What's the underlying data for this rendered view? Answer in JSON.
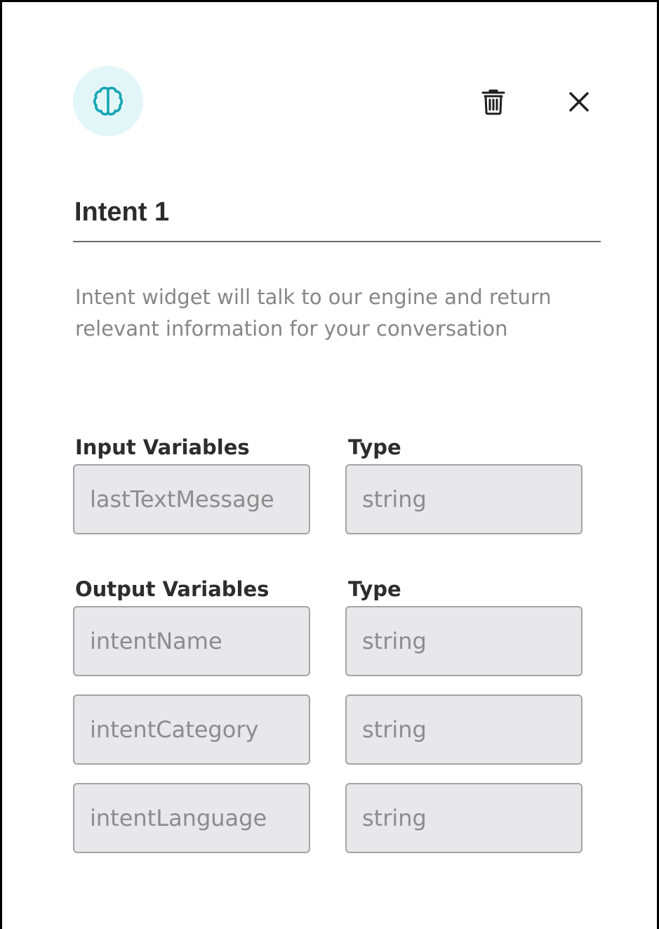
{
  "colors": {
    "accent": "#14a6b4",
    "icon_bg": "#e3f6f7",
    "field_bg": "#e8e8eb",
    "field_border": "#a3a3a8",
    "text_muted": "#868686",
    "text_dark": "#2d2d2d"
  },
  "header": {
    "widget_icon": "brain-icon",
    "delete_icon": "trash-icon",
    "close_icon": "close-icon"
  },
  "widget": {
    "title": "Intent 1",
    "description": "Intent widget will talk to our engine and return relevant information for your conversation"
  },
  "input_section": {
    "variables_label": "Input Variables",
    "type_label": "Type",
    "rows": [
      {
        "name": "lastTextMessage",
        "type": "string"
      }
    ]
  },
  "output_section": {
    "variables_label": "Output Variables",
    "type_label": "Type",
    "rows": [
      {
        "name": "intentName",
        "type": "string"
      },
      {
        "name": "intentCategory",
        "type": "string"
      },
      {
        "name": "intentLanguage",
        "type": "string"
      }
    ]
  }
}
